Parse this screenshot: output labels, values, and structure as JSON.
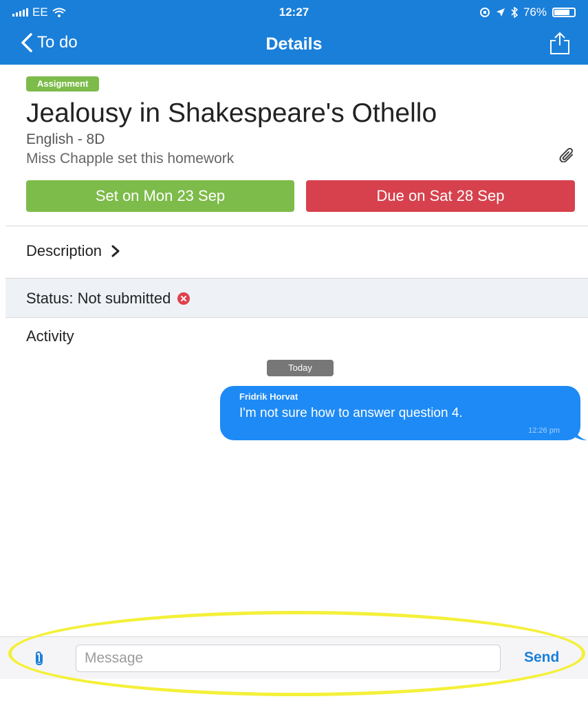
{
  "status_bar": {
    "carrier": "EE",
    "time": "12:27",
    "battery": "76%",
    "battery_level": 0.76
  },
  "nav": {
    "back_label": "To do",
    "title": "Details",
    "share_icon": "share-icon"
  },
  "homework": {
    "type_badge": "Assignment",
    "title": "Jealousy in Shakespeare's Othello",
    "subject": "English - 8D",
    "setter": "Miss Chapple set this homework",
    "set_label": "Set on Mon 23 Sep",
    "due_label": "Due on Sat 28 Sep"
  },
  "description": {
    "label": "Description"
  },
  "status": {
    "label": "Status: Not submitted"
  },
  "activity": {
    "label": "Activity",
    "day_separator": "Today",
    "messages": [
      {
        "author": "Fridrik Horvat",
        "text": "I'm not sure how to answer question 4.",
        "time": "12:26 pm"
      }
    ]
  },
  "composer": {
    "placeholder": "Message",
    "send_label": "Send"
  },
  "colors": {
    "brand_blue": "#1a7fd9",
    "set_green": "#7dbb4a",
    "due_red": "#d7414d",
    "bubble_blue": "#1e8af5",
    "highlight_yellow": "#f4f03a"
  }
}
